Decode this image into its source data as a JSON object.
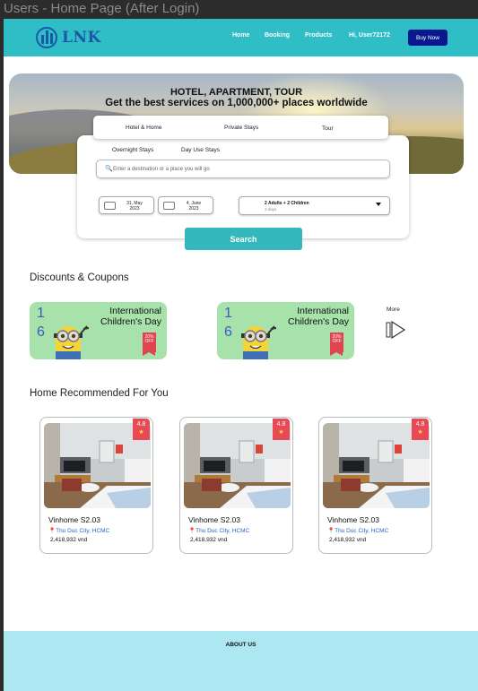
{
  "frame": {
    "title": "Users - Home Page (After Login)"
  },
  "header": {
    "logo_text": "LNK",
    "nav": [
      "Home",
      "Booking",
      "Products",
      "Hi, User72172"
    ],
    "buy_label": "Buy Now",
    "colors": {
      "bar": "#2fbdc6",
      "button": "#0a1890"
    }
  },
  "hero": {
    "title": "HOTEL, APARTMENT, TOUR",
    "subtitle": "Get the best services on  1,000,000+ places worldwide"
  },
  "search": {
    "tabs": [
      "Hotel & Home",
      "Private Stays",
      "Tour"
    ],
    "subtabs": [
      "Overnight Stays",
      "Day Use Stays"
    ],
    "destination_placeholder": "Enter a destination or a place you will go",
    "checkin": {
      "line1": "31, May",
      "line2": "2023"
    },
    "checkout": {
      "line1": "4, June",
      "line2": "2023"
    },
    "guests": {
      "summary": "2 Adults + 2 Children",
      "nights": "3 days"
    },
    "button_label": "Search",
    "button_color": "#35b8bc"
  },
  "discounts": {
    "title": "Discounts & Coupons",
    "coupons": [
      {
        "day": "1",
        "month": "6",
        "title_line1": "International",
        "title_line2": "Children's Day",
        "tag_line1": "20%",
        "tag_line2": "OFF"
      },
      {
        "day": "1",
        "month": "6",
        "title_line1": "International",
        "title_line2": "Children's Day",
        "tag_line1": "20%",
        "tag_line2": "OFF"
      }
    ],
    "more_label": "More"
  },
  "recommended": {
    "title": "Home Recommended For You",
    "cards": [
      {
        "rating": "4.8",
        "name": "Vinhome S2.03",
        "location": "Thu Duc City, HCMC",
        "price": "2,418,932 vnd"
      },
      {
        "rating": "4.8",
        "name": "Vinhome S2.03",
        "location": "Thu Duc City, HCMC",
        "price": "2,418,932 vnd"
      },
      {
        "rating": "4.8",
        "name": "Vinhome S2.03",
        "location": "Thu Duc City, HCMC",
        "price": "2,418,932 vnd"
      }
    ]
  },
  "footer": {
    "title": "ABOUT US",
    "color": "#ade7f2"
  }
}
